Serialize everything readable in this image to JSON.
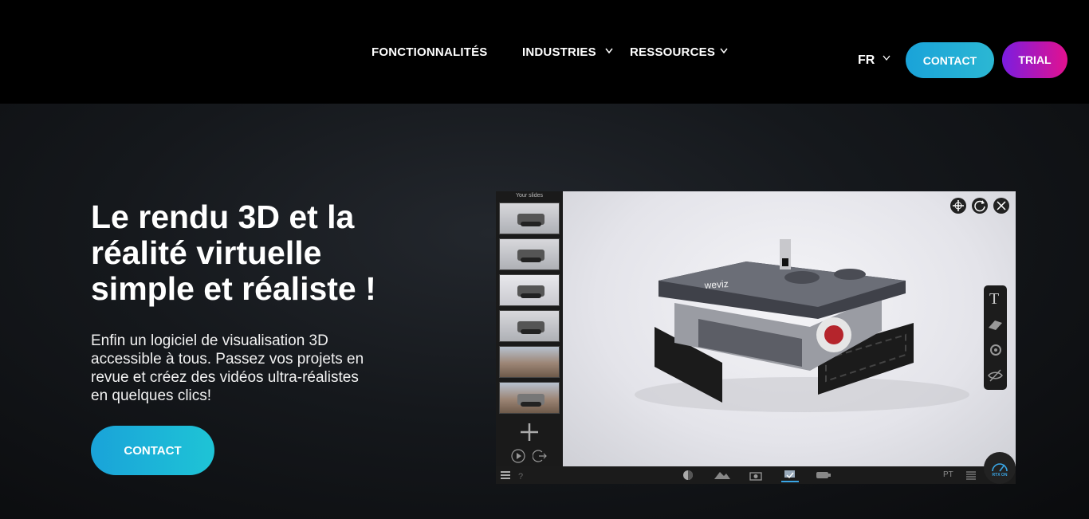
{
  "nav": {
    "items": [
      {
        "label": "FONCTIONNALITÉS"
      },
      {
        "label": "INDUSTRIES"
      },
      {
        "label": "RESSOURCES"
      }
    ],
    "lang": "FR",
    "contact_label": "CONTACT",
    "trial_label": "TRIAL"
  },
  "hero": {
    "title_lines": [
      "Le rendu 3D et la",
      "réalité virtuelle",
      "simple et réaliste  !"
    ],
    "subtitle_lines": [
      "Enfin un logiciel de visualisation 3D",
      "accessible à tous. Passez vos projets en",
      "revue et créez des vidéos ultra-réalistes",
      "en quelques clics!"
    ],
    "cta_label": "CONTACT"
  },
  "app_preview": {
    "slides_title": "Your slides",
    "slide_count": 6,
    "logo_text": "weviz",
    "bottom_right_text": "PT",
    "rtx_label": "RTX ON",
    "accent": "#3aa6e6"
  },
  "colors": {
    "contact_gradient": [
      "#1aa3d9",
      "#2bb7d3"
    ],
    "trial_gradient": [
      "#7a1de0",
      "#e3118f"
    ],
    "background": "#15181c"
  }
}
